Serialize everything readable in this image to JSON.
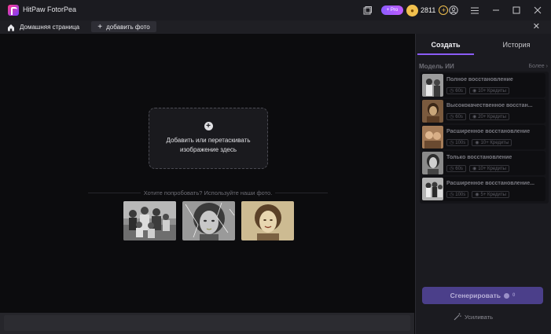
{
  "titlebar": {
    "app_title": "HitPaw FotorPea",
    "pro_label": "+ Pro",
    "credits": "2811",
    "icons": [
      "save-icon",
      "account-icon",
      "menu-icon",
      "minimize-icon",
      "maximize-icon",
      "close-icon"
    ]
  },
  "tabs": {
    "home_label": "Домашняя страница",
    "add_photo_label": "добавить фото"
  },
  "main": {
    "dropzone_text": "Добавить или перетаскивать изображение здесь",
    "try_text": "Хотите попробовать? Используйте наши фото."
  },
  "panel": {
    "tabs": [
      "Создать",
      "История"
    ],
    "model_section_title": "Модель ИИ",
    "more_label": "Более",
    "models": [
      {
        "name": "Полное восстановление",
        "time": "60s",
        "credits": "10+ Кредиты"
      },
      {
        "name": "Высококачественное восстан...",
        "time": "60s",
        "credits": "20+ Кредиты"
      },
      {
        "name": "Расширенное восстановление",
        "time": "100s",
        "credits": "10+ Кредиты"
      },
      {
        "name": "Только восстановление",
        "time": "60s",
        "credits": "10+ Кредиты"
      },
      {
        "name": "Расширенное восстановление...",
        "time": "100s",
        "credits": "5+ Кредиты"
      }
    ],
    "generate_label": "Сгенерировать",
    "generate_count": "0",
    "enhance_label": "Усиливать"
  },
  "colors": {
    "accent": "#8b5cf6",
    "coin": "#f2c14e",
    "background": "#0b0b0d",
    "panel": "#1b1b20"
  }
}
